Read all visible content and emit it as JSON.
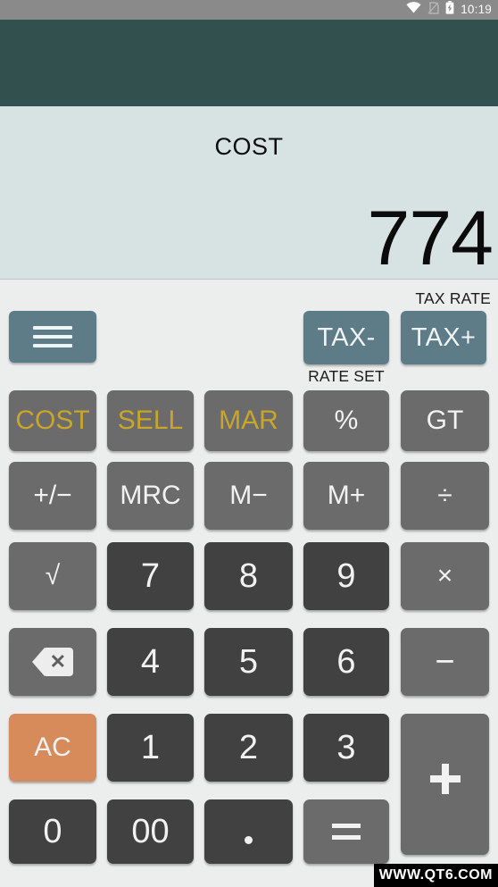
{
  "statusbar": {
    "time": "10:19",
    "icons": [
      "wifi-icon",
      "sim-card-off-icon",
      "battery-charging-icon"
    ]
  },
  "appbar": {
    "title": ""
  },
  "display": {
    "mode_label": "COST",
    "value": "774"
  },
  "tax_row": {
    "menu_button": "menu-icon",
    "tax_minus": "TAX-",
    "tax_plus": "TAX+",
    "label_top": "TAX RATE",
    "label_bottom": "RATE SET"
  },
  "keypad": {
    "row1": [
      {
        "label": "COST",
        "style": "gold"
      },
      {
        "label": "SELL",
        "style": "gold"
      },
      {
        "label": "MAR",
        "style": "gold"
      },
      {
        "label": "%",
        "style": "fn"
      },
      {
        "label": "GT",
        "style": "fn"
      }
    ],
    "row2": [
      {
        "label": "+/−",
        "style": "fn"
      },
      {
        "label": "MRC",
        "style": "fn"
      },
      {
        "label": "M−",
        "style": "fn"
      },
      {
        "label": "M+",
        "style": "fn"
      },
      {
        "label": "÷",
        "style": "fn"
      }
    ],
    "row3": [
      {
        "label": "√",
        "style": "fn"
      },
      {
        "label": "7",
        "style": "num"
      },
      {
        "label": "8",
        "style": "num"
      },
      {
        "label": "9",
        "style": "num"
      },
      {
        "label": "×",
        "style": "fn"
      }
    ],
    "row4": [
      {
        "label": "backspace-icon",
        "style": "fn"
      },
      {
        "label": "4",
        "style": "num"
      },
      {
        "label": "5",
        "style": "num"
      },
      {
        "label": "6",
        "style": "num"
      },
      {
        "label": "−",
        "style": "fn"
      }
    ],
    "row5": [
      {
        "label": "AC",
        "style": "ac"
      },
      {
        "label": "1",
        "style": "num"
      },
      {
        "label": "2",
        "style": "num"
      },
      {
        "label": "3",
        "style": "num"
      },
      {
        "label": "+",
        "style": "fn"
      }
    ],
    "row6": [
      {
        "label": "0",
        "style": "num"
      },
      {
        "label": "00",
        "style": "num"
      },
      {
        "label": ".",
        "style": "num"
      },
      {
        "label": "=",
        "style": "fn"
      }
    ]
  },
  "watermark": {
    "text": "WWW.QT6.COM"
  },
  "colors": {
    "appbar": "#32504d",
    "display_bg": "#d7e3e3",
    "keypad_bg": "#eceded",
    "function_key": "#6b6b6b",
    "number_key": "#414141",
    "accent_gold": "#c9a52a",
    "ac_orange": "#d78b5a",
    "tax_button": "#5d7c88"
  }
}
